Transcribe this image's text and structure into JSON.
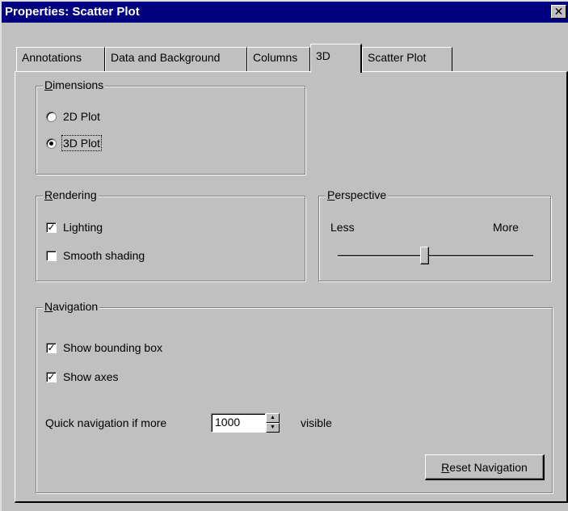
{
  "window": {
    "title": "Properties: Scatter Plot",
    "close_label": "✕"
  },
  "tabs": [
    {
      "label": "Annotations",
      "active": false
    },
    {
      "label": "Data and Background",
      "active": false
    },
    {
      "label": "Columns",
      "active": false
    },
    {
      "label": "3D",
      "active": true
    },
    {
      "label": "Scatter Plot",
      "active": false
    }
  ],
  "dimensions": {
    "legend_first": "D",
    "legend_rest": "imensions",
    "options": [
      {
        "label": "2D Plot",
        "selected": false
      },
      {
        "label": "3D Plot",
        "selected": true
      }
    ]
  },
  "rendering": {
    "legend_first": "R",
    "legend_rest": "endering",
    "lighting_label": "Lighting",
    "lighting_checked": true,
    "smooth_label": "Smooth shading",
    "smooth_checked": false
  },
  "perspective": {
    "legend_first": "P",
    "legend_rest": "erspective",
    "less_label": "Less",
    "more_label": "More",
    "level": 0.44
  },
  "navigation": {
    "legend_first": "N",
    "legend_rest": "avigation",
    "bounding_label": "Show bounding box",
    "bounding_checked": true,
    "axes_label": "Show axes",
    "axes_checked": true,
    "quick_label": "Quick navigation if more",
    "quick_value": "1000",
    "visible_label": "visible",
    "reset_first": "R",
    "reset_rest": "eset Navigation"
  },
  "check_glyph": "✓"
}
